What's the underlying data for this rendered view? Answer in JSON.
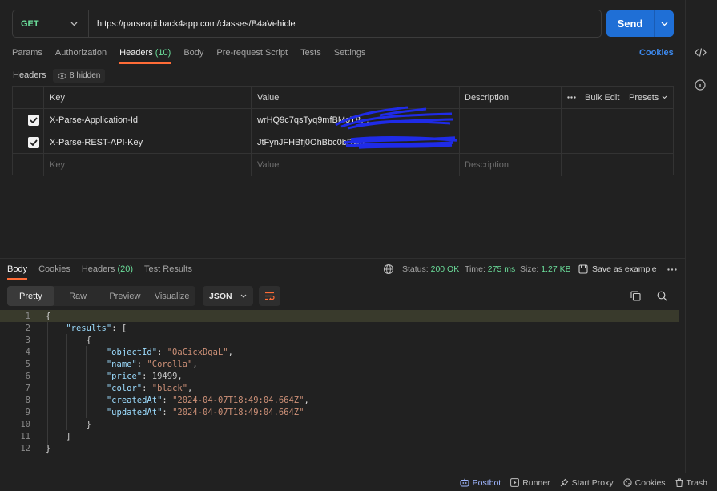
{
  "request": {
    "method": "GET",
    "url": "https://parseapi.back4app.com/classes/B4aVehicle",
    "send_label": "Send"
  },
  "tabs": [
    {
      "label": "Params"
    },
    {
      "label": "Authorization"
    },
    {
      "label": "Headers",
      "count": "(10)"
    },
    {
      "label": "Body"
    },
    {
      "label": "Pre-request Script"
    },
    {
      "label": "Tests"
    },
    {
      "label": "Settings"
    }
  ],
  "cookies_link": "Cookies",
  "headers_section": {
    "label": "Headers",
    "hidden_badge": "8 hidden",
    "columns": {
      "key": "Key",
      "value": "Value",
      "description": "Description"
    },
    "bulk_edit": "Bulk Edit",
    "presets": "Presets",
    "rows": [
      {
        "key": "X-Parse-Application-Id",
        "value": "wrHQ9c7qsTyq9mfBMoT8"
      },
      {
        "key": "X-Parse-REST-API-Key",
        "value": "JtFynJFHBfj0OhBbc0bDwp"
      }
    ],
    "placeholder": {
      "key": "Key",
      "value": "Value",
      "description": "Description"
    }
  },
  "response": {
    "tabs": [
      {
        "label": "Body"
      },
      {
        "label": "Cookies"
      },
      {
        "label": "Headers",
        "count": "(20)"
      },
      {
        "label": "Test Results"
      }
    ],
    "status_label": "Status:",
    "status_value": "200 OK",
    "time_label": "Time:",
    "time_value": "275 ms",
    "size_label": "Size:",
    "size_value": "1.27 KB",
    "save_label": "Save as example",
    "view_modes": [
      "Pretty",
      "Raw",
      "Preview",
      "Visualize"
    ],
    "format": "JSON",
    "line_numbers": [
      "1",
      "2",
      "3",
      "4",
      "5",
      "6",
      "7",
      "8",
      "9",
      "10",
      "11",
      "12"
    ],
    "json": {
      "results_key": "\"results\"",
      "fields": [
        {
          "key": "\"objectId\"",
          "value": "\"OaCicxDqaL\"",
          "type": "string"
        },
        {
          "key": "\"name\"",
          "value": "\"Corolla\"",
          "type": "string"
        },
        {
          "key": "\"price\"",
          "value": "19499",
          "type": "number"
        },
        {
          "key": "\"color\"",
          "value": "\"black\"",
          "type": "string"
        },
        {
          "key": "\"createdAt\"",
          "value": "\"2024-04-07T18:49:04.664Z\"",
          "type": "string"
        },
        {
          "key": "\"updatedAt\"",
          "value": "\"2024-04-07T18:49:04.664Z\"",
          "type": "string"
        }
      ]
    }
  },
  "footer": {
    "postbot": "Postbot",
    "runner": "Runner",
    "proxy": "Start Proxy",
    "cookies": "Cookies",
    "trash": "Trash"
  },
  "icons": [
    "chevron-down-icon",
    "code-icon",
    "info-icon",
    "eye-icon",
    "more-icon",
    "globe-icon",
    "save-icon",
    "wrap-icon",
    "copy-icon",
    "search-icon",
    "checkbox-icon"
  ],
  "colors": {
    "accent": "#ff6c37",
    "send": "#1f6fd6",
    "success": "#6bdd9a",
    "link": "#3d8bf2"
  }
}
